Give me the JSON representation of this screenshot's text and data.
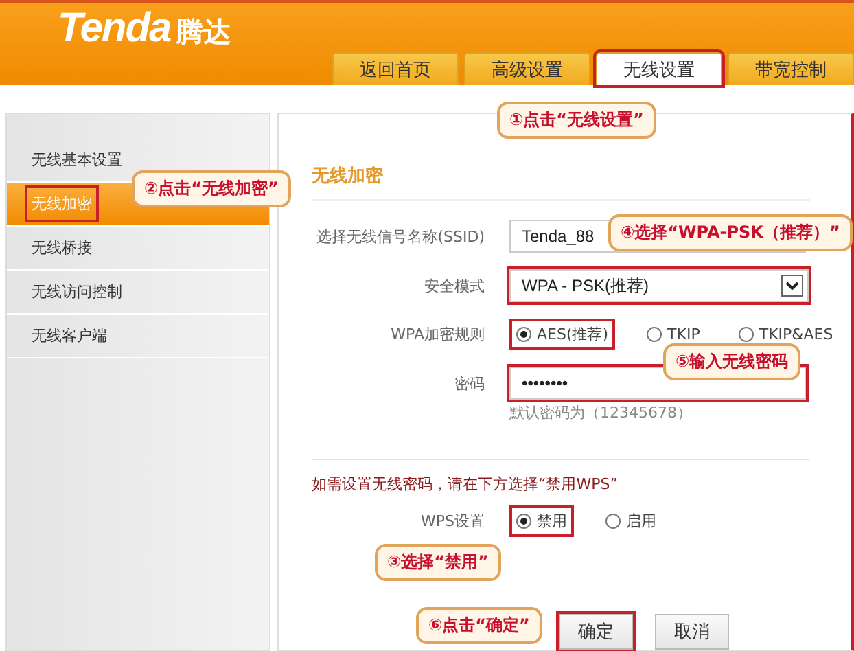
{
  "header": {
    "logo": "Tenda",
    "logo_cn": "腾达"
  },
  "tabs": [
    {
      "label": "返回首页",
      "selected": false,
      "highlighted": false
    },
    {
      "label": "高级设置",
      "selected": false,
      "highlighted": false
    },
    {
      "label": "无线设置",
      "selected": true,
      "highlighted": true
    },
    {
      "label": "带宽控制",
      "selected": false,
      "highlighted": false
    }
  ],
  "sidebar": {
    "items": [
      {
        "label": "无线基本设置",
        "selected": false,
        "highlighted": false
      },
      {
        "label": "无线加密",
        "selected": true,
        "highlighted": true
      },
      {
        "label": "无线桥接",
        "selected": false,
        "highlighted": false
      },
      {
        "label": "无线访问控制",
        "selected": false,
        "highlighted": false
      },
      {
        "label": "无线客户端",
        "selected": false,
        "highlighted": false
      }
    ]
  },
  "panel": {
    "title": "无线加密",
    "ssid": {
      "label": "选择无线信号名称(SSID)",
      "value": "Tenda_88",
      "highlighted": false
    },
    "mode": {
      "label": "安全模式",
      "value": "WPA - PSK(推荐)",
      "highlighted": true
    },
    "cipher": {
      "label": "WPA加密规则",
      "options": [
        {
          "label": "AES(推荐)",
          "selected": true,
          "highlighted": true
        },
        {
          "label": "TKIP",
          "selected": false,
          "highlighted": false
        },
        {
          "label": "TKIP&AES",
          "selected": false,
          "highlighted": false
        }
      ]
    },
    "password": {
      "label": "密码",
      "value": "••••••••",
      "highlighted": true,
      "hint": "默认密码为（12345678）"
    },
    "wps_note": "如需设置无线密码，请在下方选择“禁用WPS”",
    "wps": {
      "label": "WPS设置",
      "options": [
        {
          "label": "禁用",
          "selected": true,
          "highlighted": true
        },
        {
          "label": "启用",
          "selected": false,
          "highlighted": false
        }
      ]
    },
    "buttons": [
      {
        "label": "确定",
        "highlighted": true
      },
      {
        "label": "取消",
        "highlighted": false
      }
    ]
  },
  "callouts": [
    {
      "text": "①点击“无线设置”"
    },
    {
      "text": "②点击“无线加密”"
    },
    {
      "text": "④选择“WPA-PSK（推荐）”"
    },
    {
      "text": "⑤输入无线密码"
    },
    {
      "text": "③选择“禁用”"
    },
    {
      "text": "⑥点击“确定”"
    }
  ]
}
